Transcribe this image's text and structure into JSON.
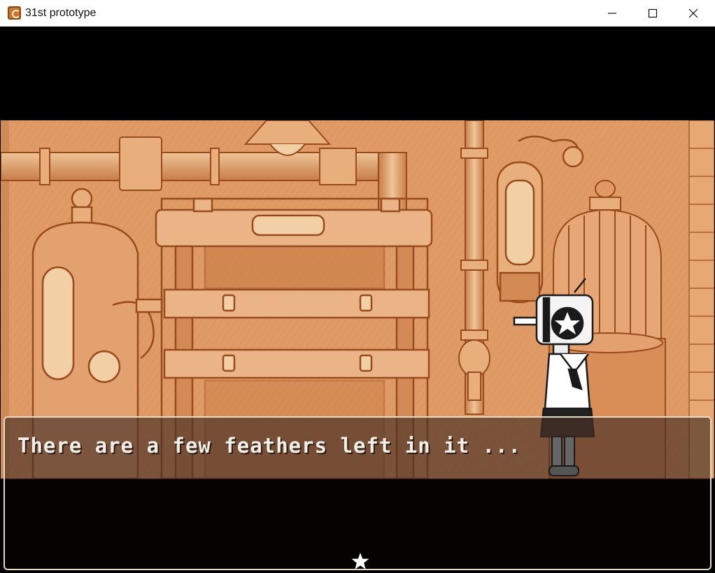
{
  "window": {
    "title": "31st prototype",
    "icons": [
      "app-icon",
      "minimize-icon",
      "maximize-icon",
      "close-icon"
    ]
  },
  "scene": {
    "palette": {
      "base": "#df9a65",
      "ink": "#9a4b1e",
      "light": "#f0c497"
    }
  },
  "dialog": {
    "text": "There are a few feathers left in it ...",
    "advance_icon": "star-icon",
    "colors": {
      "text": "#f2eee8",
      "border": "#e9d9bf"
    }
  }
}
